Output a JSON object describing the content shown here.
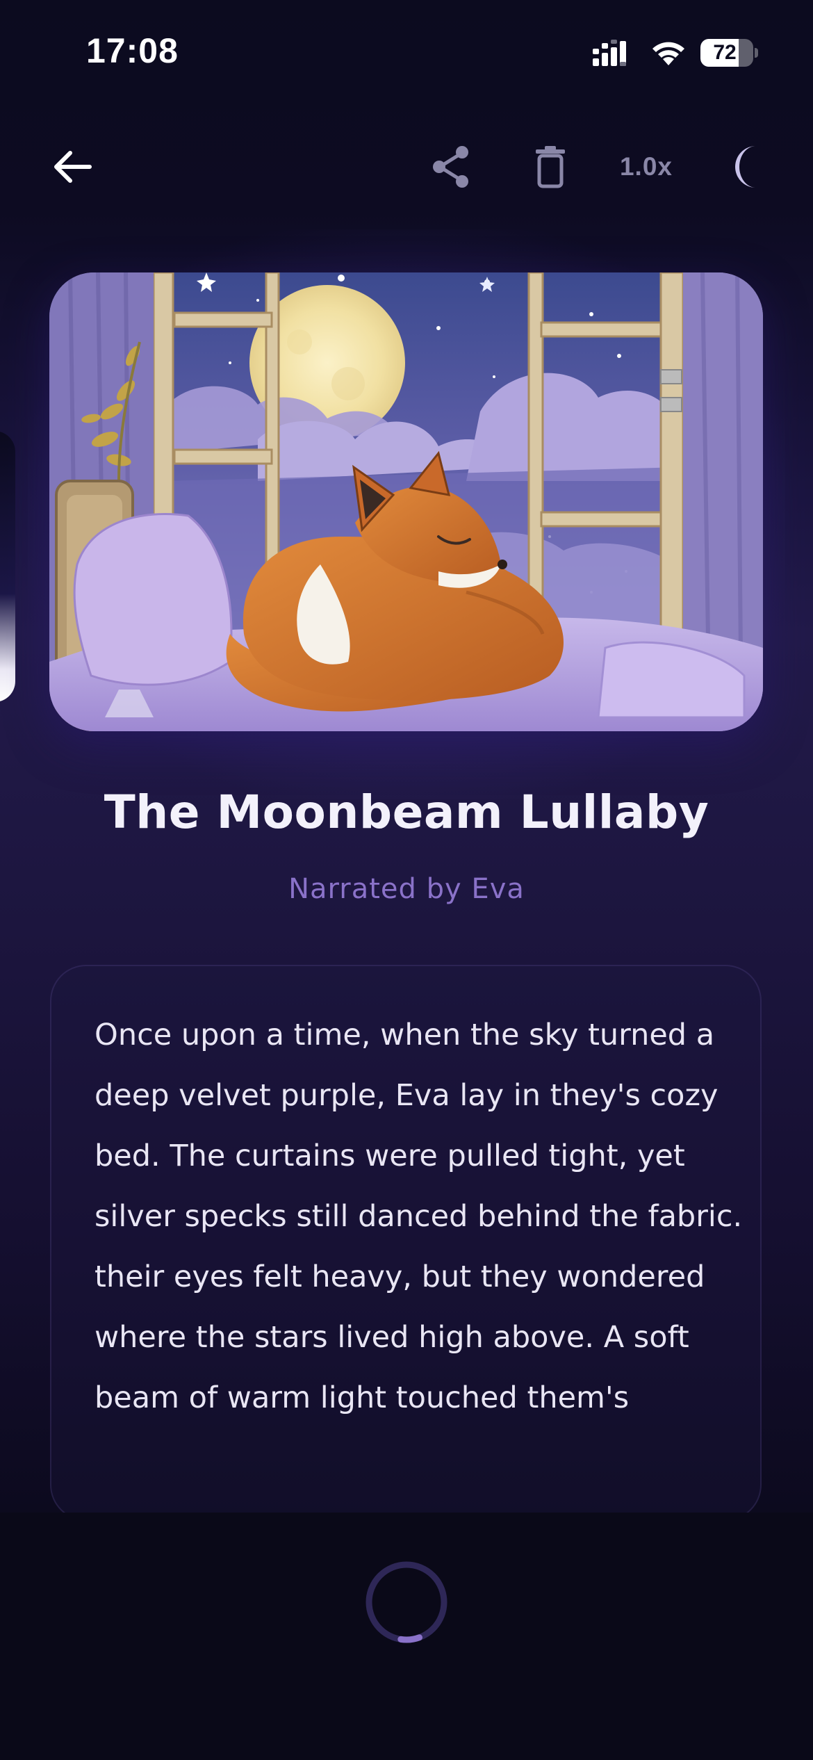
{
  "status_bar": {
    "time": "17:08",
    "battery_level": "72",
    "battery_fraction": 0.72,
    "icons": [
      "signal-icon",
      "wifi-icon",
      "battery-icon"
    ]
  },
  "toolbar": {
    "back_icon": "arrow-left-icon",
    "share_icon": "share-icon",
    "delete_icon": "trash-icon",
    "speed_label": "1.0x",
    "sleep_icon": "moon-icon"
  },
  "story": {
    "cover_description_icon": "sleeping-fox-artwork",
    "title": "The Moonbeam Lullaby",
    "narrator": "Narrated by Eva",
    "text": "Once upon a time, when the sky turned a deep velvet purple, Eva lay in they's cozy bed. The curtains were pulled tight, yet silver specks still danced behind the fabric. their eyes felt heavy, but they wondered where the stars lived high above. A soft beam of warm light touched them's"
  },
  "player": {
    "state_icon": "loading-spinner-icon",
    "progress_fraction": 0.08
  },
  "colors": {
    "background": "#0c0b1f",
    "accent": "#8a72c9",
    "title": "#f3f1fb",
    "muted_icon": "#8a87a8"
  }
}
